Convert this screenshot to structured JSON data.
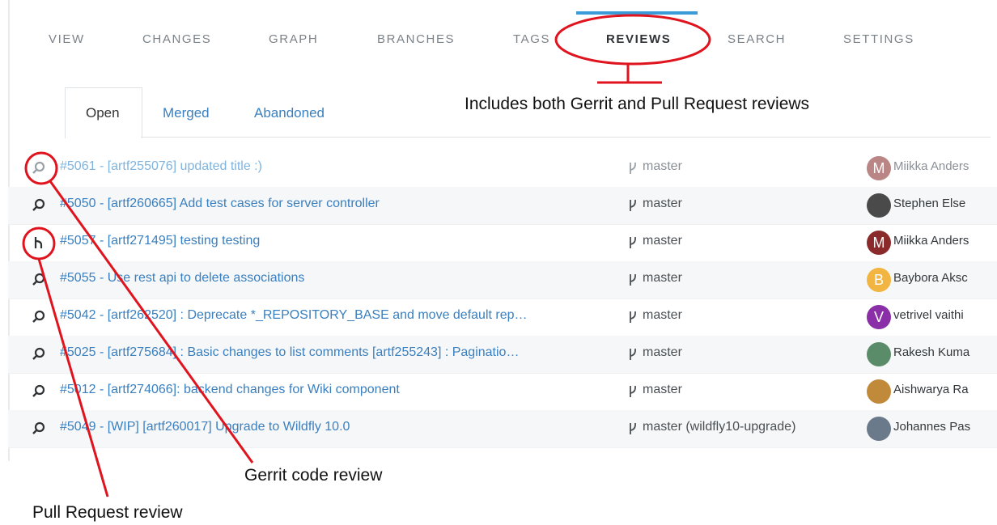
{
  "nav": {
    "tabs": [
      {
        "label": "VIEW"
      },
      {
        "label": "CHANGES"
      },
      {
        "label": "GRAPH"
      },
      {
        "label": "BRANCHES"
      },
      {
        "label": "TAGS"
      },
      {
        "label": "REVIEWS"
      },
      {
        "label": "SEARCH"
      },
      {
        "label": "SETTINGS"
      }
    ],
    "active": "REVIEWS"
  },
  "subtabs": [
    {
      "label": "Open"
    },
    {
      "label": "Merged"
    },
    {
      "label": "Abandoned"
    }
  ],
  "reviews": [
    {
      "title": "#5061 - [artf255076] updated title :)",
      "branch": "master",
      "author": "Miikka Anders",
      "avatar_letter": "M",
      "avatar_color": "#b98585",
      "type": "gerrit",
      "faded": true
    },
    {
      "title": "#5050 - [artf260665] Add test cases for server controller",
      "branch": "master",
      "author": "Stephen Else",
      "avatar_letter": "",
      "avatar_color": "#4a4a4a",
      "type": "gerrit",
      "faded": false
    },
    {
      "title": "#5057 - [artf271495] testing testing",
      "branch": "master",
      "author": "Miikka Anders",
      "avatar_letter": "M",
      "avatar_color": "#8b2a2a",
      "type": "pull-request",
      "faded": false
    },
    {
      "title": "#5055 - Use rest api to delete associations",
      "branch": "master",
      "author": "Baybora Aksc",
      "avatar_letter": "B",
      "avatar_color": "#f2b542",
      "type": "gerrit",
      "faded": false
    },
    {
      "title": "#5042 - [artf262520] : Deprecate *_REPOSITORY_BASE and move default rep…",
      "branch": "master",
      "author": "vetrivel vaithi",
      "avatar_letter": "V",
      "avatar_color": "#8b2fa8",
      "type": "gerrit",
      "faded": false
    },
    {
      "title": "#5025 - [artf275684] : Basic changes to list comments [artf255243] : Paginatio…",
      "branch": "master",
      "author": "Rakesh Kuma",
      "avatar_letter": "",
      "avatar_color": "#5b8c6a",
      "type": "gerrit",
      "faded": false
    },
    {
      "title": "#5012 - [artf274066]: backend changes for Wiki component",
      "branch": "master",
      "author": "Aishwarya Ra",
      "avatar_letter": "",
      "avatar_color": "#c08a3a",
      "type": "gerrit",
      "faded": false
    },
    {
      "title": "#5049 - [WIP] [artf260017] Upgrade to Wildfly 10.0",
      "branch": "master (wildfly10-upgrade)",
      "author": "Johannes Pas",
      "avatar_letter": "",
      "avatar_color": "#6a7a8a",
      "type": "gerrit",
      "faded": false
    }
  ],
  "annotations": {
    "reviews_note": "Includes both Gerrit and Pull Request reviews",
    "gerrit_note": "Gerrit code review",
    "pr_note": "Pull Request review"
  },
  "colors": {
    "link": "#3a7fbf",
    "accent": "#3a9bd9",
    "annotation": "#e0141e"
  }
}
